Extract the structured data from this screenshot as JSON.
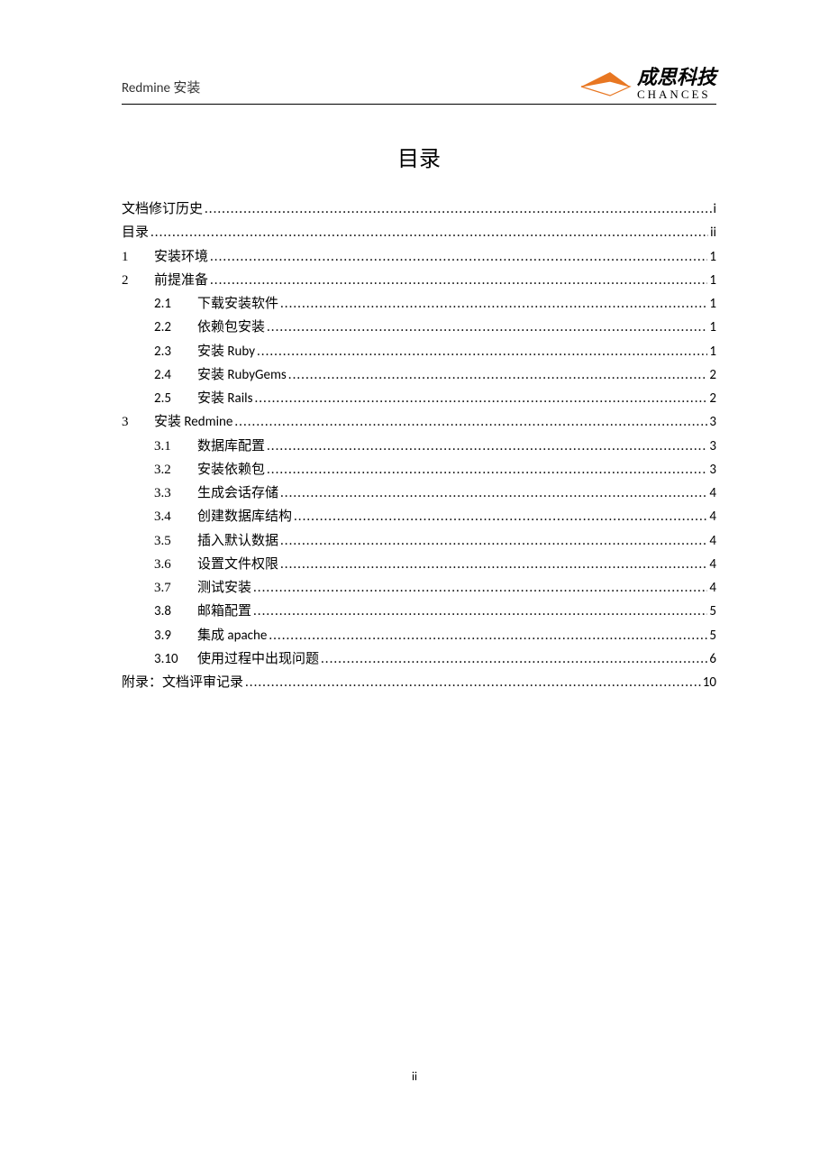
{
  "header": {
    "title": "Redmine 安装",
    "logo_cn": "成思科技",
    "logo_en": "CHANCES"
  },
  "toc_title": "目录",
  "toc": [
    {
      "level": 1,
      "num": "",
      "label": "文档修订历史",
      "page": "i"
    },
    {
      "level": 1,
      "num": "",
      "label": "目录",
      "page": "ii"
    },
    {
      "level": 1,
      "num": "1",
      "label": "安装环境",
      "page": "1"
    },
    {
      "level": 1,
      "num": "2",
      "label": "前提准备",
      "page": "1"
    },
    {
      "level": 2,
      "num": "2.1",
      "label": "下载安装软件 ",
      "page": "1"
    },
    {
      "level": 2,
      "num": "2.2",
      "label": "依赖包安装 ",
      "page": "1"
    },
    {
      "level": 2,
      "num": "2.3",
      "label": "安装 Ruby ",
      "page": "1"
    },
    {
      "level": 2,
      "num": "2.4",
      "label": "安装 RubyGems",
      "page": "2"
    },
    {
      "level": 2,
      "num": "2.5",
      "label": "安装 Rails",
      "page": "2"
    },
    {
      "level": 1,
      "num": "3",
      "label": "安装 Redmine",
      "page": "3"
    },
    {
      "level": 2,
      "num": "3.1",
      "num_cn": true,
      "label": "数据库配置",
      "page": "3"
    },
    {
      "level": 2,
      "num": "3.2",
      "num_cn": true,
      "label": "安装依赖包",
      "page": "3"
    },
    {
      "level": 2,
      "num": "3.3",
      "num_cn": true,
      "label": "生成会话存储",
      "page": "4"
    },
    {
      "level": 2,
      "num": "3.4",
      "num_cn": true,
      "label": "创建数据库结构",
      "page": "4"
    },
    {
      "level": 2,
      "num": "3.5",
      "num_cn": true,
      "label": "插入默认数据",
      "page": "4"
    },
    {
      "level": 2,
      "num": "3.6",
      "num_cn": true,
      "label": "设置文件权限",
      "page": "4"
    },
    {
      "level": 2,
      "num": "3.7",
      "num_cn": true,
      "label": "测试安装",
      "page": "4"
    },
    {
      "level": 2,
      "num": "3.8",
      "label": "邮箱配置 ",
      "page": "5"
    },
    {
      "level": 2,
      "num": "3.9",
      "label": "集成 apache",
      "page": "5"
    },
    {
      "level": 2,
      "num": "3.10",
      "label": "使用过程中出现问题 ",
      "page": "6"
    },
    {
      "level": 1,
      "num": "",
      "label": "附录：文档评审记录",
      "page": "10"
    }
  ],
  "footer_page": "ii"
}
